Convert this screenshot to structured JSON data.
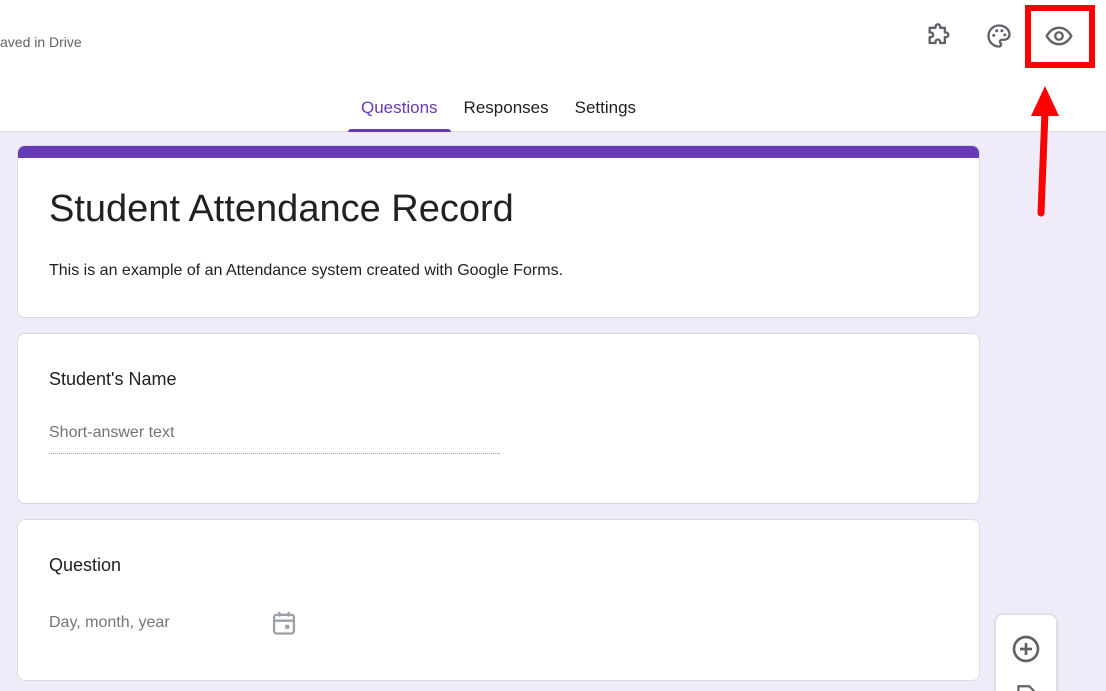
{
  "header": {
    "saved_status": "aved in Drive"
  },
  "toolbar": {
    "addon_icon": "puzzle-icon",
    "palette_icon": "palette-icon",
    "preview_icon": "eye-icon"
  },
  "tabs": [
    {
      "label": "Questions",
      "active": true
    },
    {
      "label": "Responses",
      "active": false
    },
    {
      "label": "Settings",
      "active": false
    }
  ],
  "form": {
    "title": "Student Attendance Record",
    "description": "This is an example of an Attendance system created with Google Forms.",
    "questions": [
      {
        "title": "Student's Name",
        "type": "short-answer",
        "placeholder": "Short-answer text"
      },
      {
        "title": "Question",
        "type": "date",
        "placeholder": "Day, month, year"
      }
    ]
  },
  "colors": {
    "accent": "#673ab7",
    "background": "#f0ebf8",
    "annotation": "#ff0000"
  }
}
